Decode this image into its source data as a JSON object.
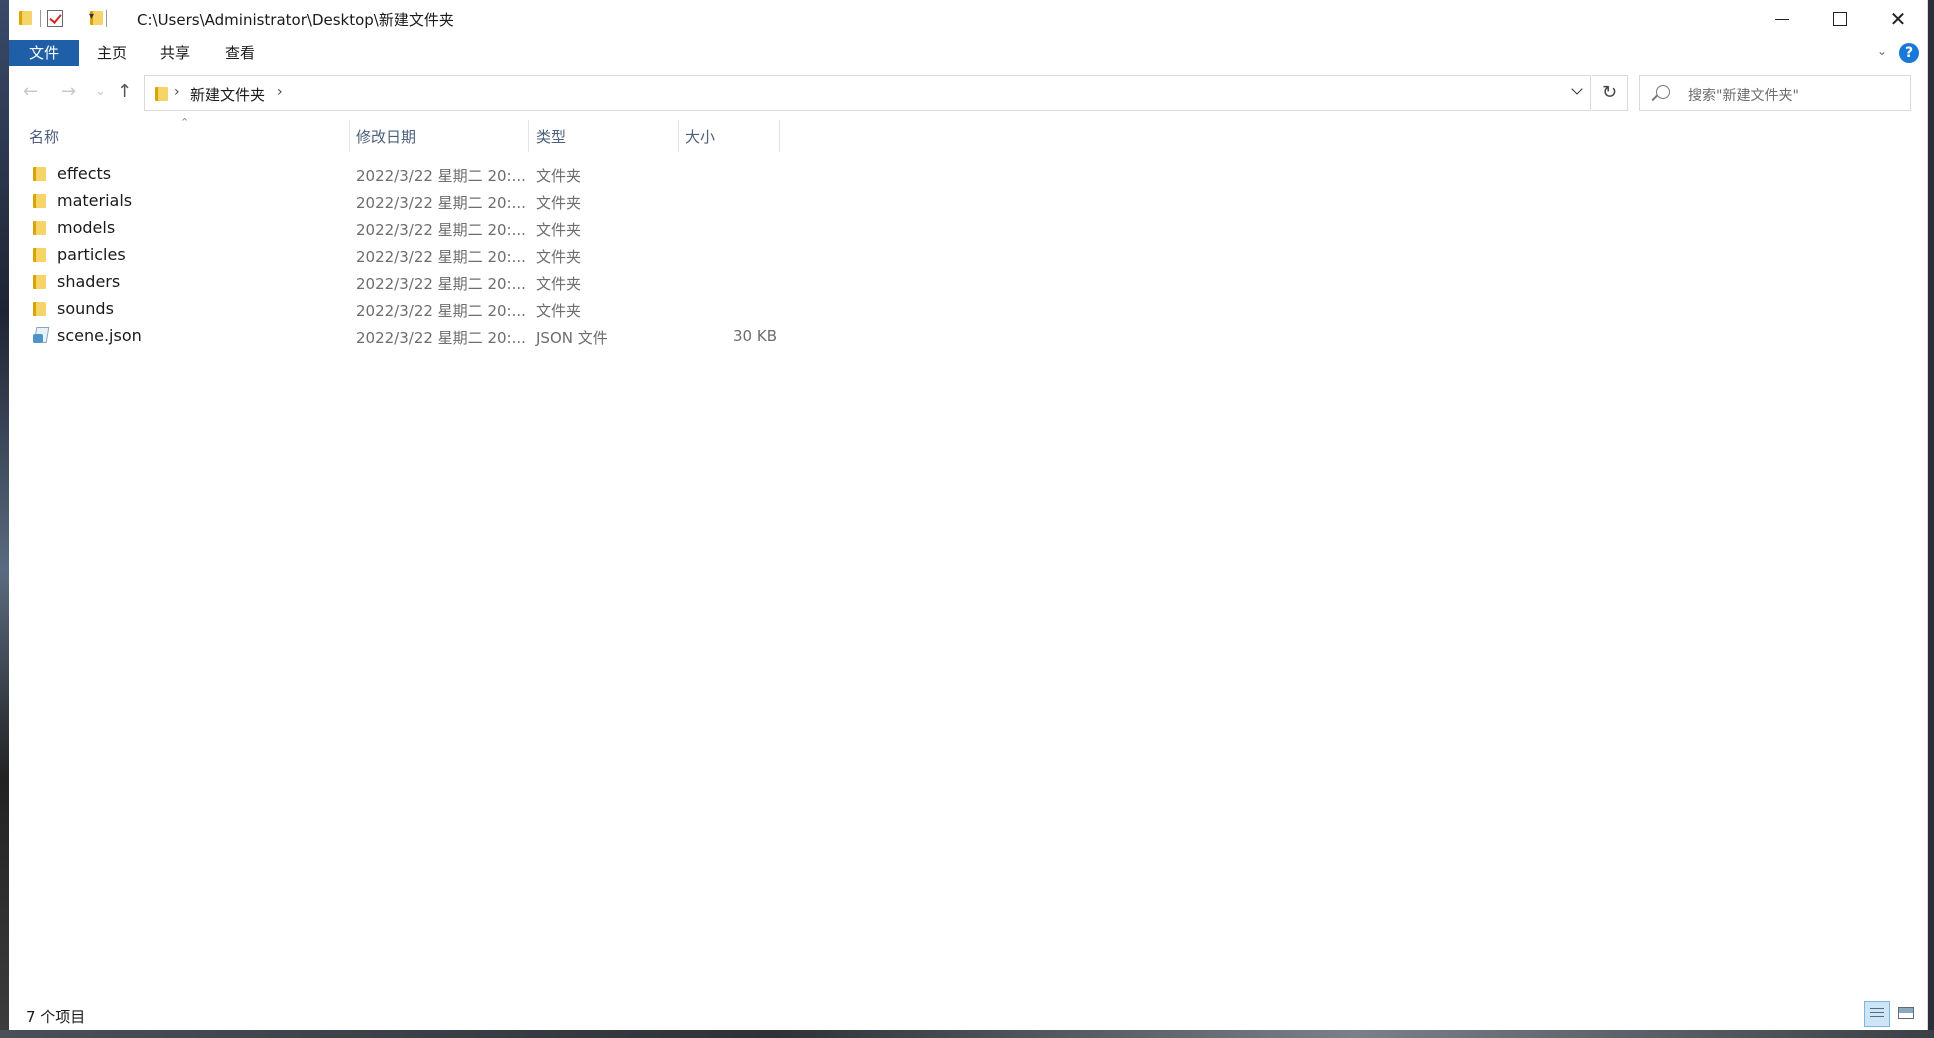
{
  "window": {
    "title": "C:\\Users\\Administrator\\Desktop\\新建文件夹",
    "minimize": "—",
    "maximize": "☐",
    "close": "✕"
  },
  "ribbon": {
    "tabs": [
      "文件",
      "主页",
      "共享",
      "查看"
    ],
    "help": "?"
  },
  "nav": {
    "back": "←",
    "forward": "→",
    "recent": "⌄",
    "up": "↑",
    "breadcrumb": [
      "新建文件夹"
    ],
    "refresh": "↻",
    "search_placeholder": "搜索\"新建文件夹\""
  },
  "columns": {
    "name": "名称",
    "date": "修改日期",
    "type": "类型",
    "size": "大小"
  },
  "files": [
    {
      "name": "effects",
      "date": "2022/3/22 星期二 20:...",
      "type": "文件夹",
      "size": "",
      "icon": "folder-icon"
    },
    {
      "name": "materials",
      "date": "2022/3/22 星期二 20:...",
      "type": "文件夹",
      "size": "",
      "icon": "folder-icon"
    },
    {
      "name": "models",
      "date": "2022/3/22 星期二 20:...",
      "type": "文件夹",
      "size": "",
      "icon": "folder-icon"
    },
    {
      "name": "particles",
      "date": "2022/3/22 星期二 20:...",
      "type": "文件夹",
      "size": "",
      "icon": "folder-icon"
    },
    {
      "name": "shaders",
      "date": "2022/3/22 星期二 20:...",
      "type": "文件夹",
      "size": "",
      "icon": "folder-icon"
    },
    {
      "name": "sounds",
      "date": "2022/3/22 星期二 20:...",
      "type": "文件夹",
      "size": "",
      "icon": "folder-icon"
    },
    {
      "name": "scene.json",
      "date": "2022/3/22 星期二 20:...",
      "type": "JSON 文件",
      "size": "30 KB",
      "icon": "json-file-icon"
    }
  ],
  "status": {
    "item_count": "7 个项目"
  },
  "colors": {
    "file_tab": "#1f5fa8",
    "folder": "#f7d468",
    "header_text": "#4c607a",
    "help": "#1a78d6"
  }
}
